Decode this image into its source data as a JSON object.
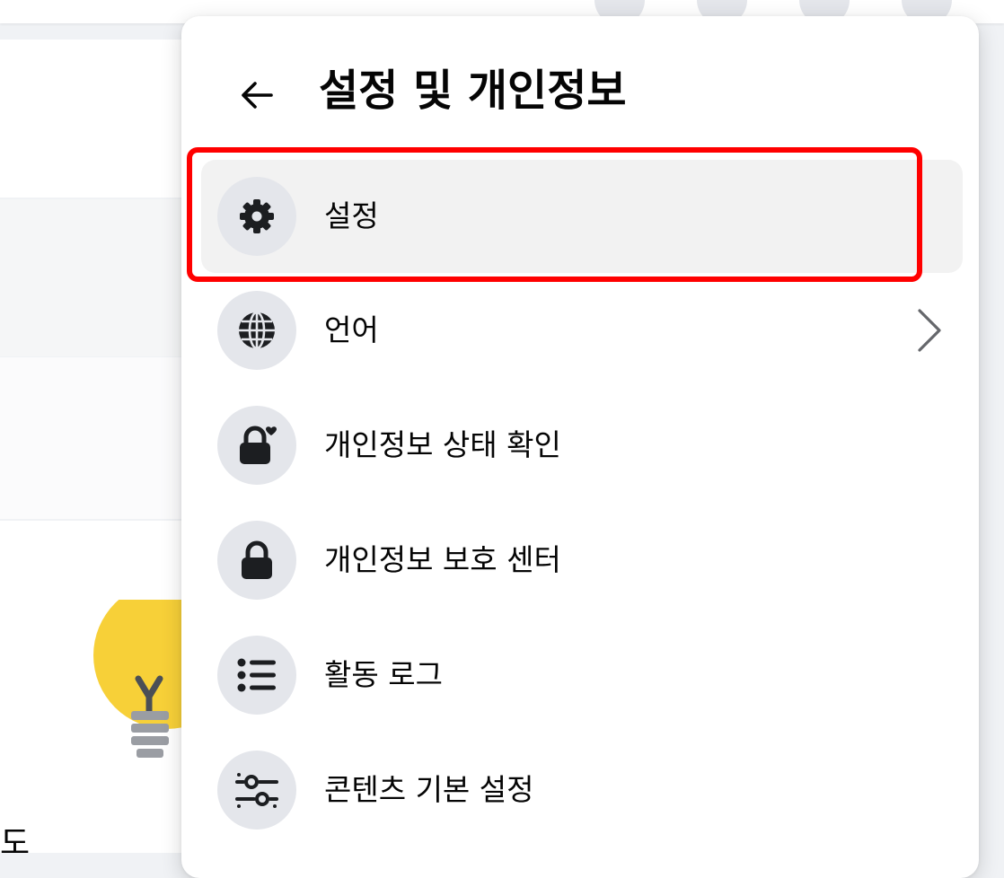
{
  "panel": {
    "title": "설정 및 개인정보",
    "items": [
      {
        "label": "설정",
        "icon": "gear-icon",
        "active": true,
        "has_chevron": false
      },
      {
        "label": "언어",
        "icon": "globe-icon",
        "active": false,
        "has_chevron": true
      },
      {
        "label": "개인정보 상태 확인",
        "icon": "lock-heart-icon",
        "active": false,
        "has_chevron": false
      },
      {
        "label": "개인정보 보호 센터",
        "icon": "lock-icon",
        "active": false,
        "has_chevron": false
      },
      {
        "label": "활동 로그",
        "icon": "list-icon",
        "active": false,
        "has_chevron": false
      },
      {
        "label": "콘텐츠 기본 설정",
        "icon": "sliders-icon",
        "active": false,
        "has_chevron": false
      }
    ]
  },
  "background": {
    "partial_text": "도"
  },
  "colors": {
    "panel_bg": "#ffffff",
    "page_bg": "#f0f2f5",
    "icon_circle": "#e4e6eb",
    "active_row": "#f2f2f2",
    "highlight": "#ff0000",
    "bulb": "#f7d038"
  }
}
